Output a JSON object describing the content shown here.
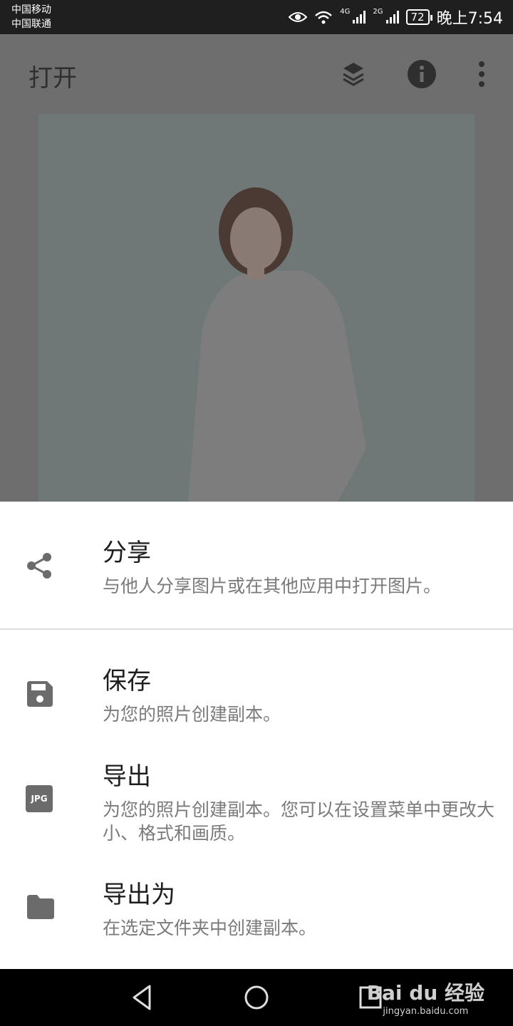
{
  "status_bar": {
    "carrier1": "中国移动",
    "carrier2": "中国联通",
    "net1": "4G",
    "net2": "2G",
    "battery": "72",
    "time": "晚上7:54"
  },
  "app_bar": {
    "title": "打开",
    "icons": [
      "layers-swap-icon",
      "info-icon",
      "more-vert-icon"
    ]
  },
  "sheet": {
    "items": [
      {
        "icon": "share-icon",
        "title": "分享",
        "subtitle": "与他人分享图片或在其他应用中打开图片。"
      },
      {
        "icon": "save-icon",
        "title": "保存",
        "subtitle": "为您的照片创建副本。"
      },
      {
        "icon": "jpg-icon",
        "icon_text": "JPG",
        "title": "导出",
        "subtitle": "为您的照片创建副本。您可以在设置菜单中更改大小、格式和画质。"
      },
      {
        "icon": "folder-icon",
        "title": "导出为",
        "subtitle": "在选定文件夹中创建副本。"
      }
    ]
  },
  "watermark": {
    "logo": "Bai du 经验",
    "url": "jingyan.baidu.com"
  },
  "colors": {
    "scrim": "#6e6e6e",
    "sheet_bg": "#ffffff",
    "icon_grey": "#6b6b6b",
    "statusbar": "#1f1f1f"
  }
}
